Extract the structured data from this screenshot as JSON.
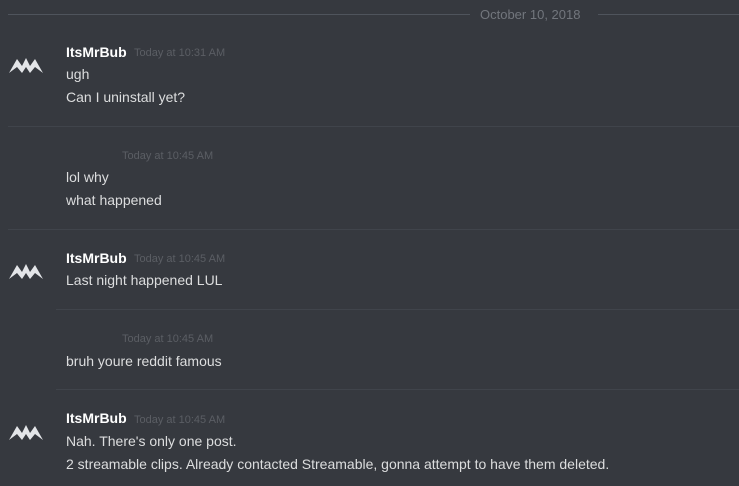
{
  "divider": {
    "date": "October 10, 2018"
  },
  "groups": [
    {
      "author": "ItsMrBub",
      "timestamp": "Today at 10:31 AM",
      "lines": [
        "ugh",
        "Can I uninstall yet?"
      ]
    },
    {
      "author": "",
      "timestamp": "Today at 10:45 AM",
      "lines": [
        "lol why",
        "what happened"
      ]
    },
    {
      "author": "ItsMrBub",
      "timestamp": "Today at 10:45 AM",
      "lines": [
        "Last night happened LUL"
      ]
    },
    {
      "author": "",
      "timestamp": "Today at 10:45 AM",
      "lines": [
        "bruh youre reddit famous"
      ]
    },
    {
      "author": "ItsMrBub",
      "timestamp": "Today at 10:45 AM",
      "lines": [
        "Nah. There's only one post.",
        "2 streamable clips. Already contacted Streamable, gonna attempt to have them deleted."
      ]
    }
  ],
  "avatar_icon": "mountain-logo-icon",
  "colors": {
    "background": "#36393f",
    "username": "#ffffff",
    "message": "#dcddde",
    "timestamp": "#5b5e64",
    "divider_text": "#72767d"
  }
}
